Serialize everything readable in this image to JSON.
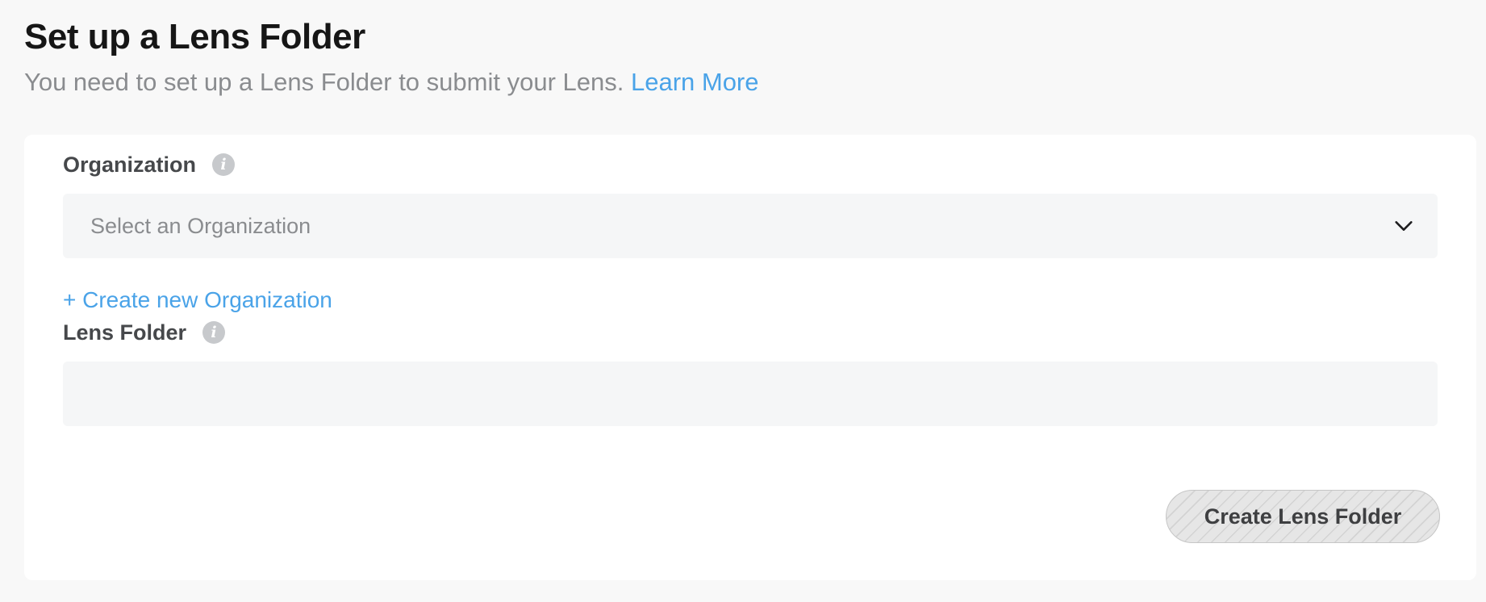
{
  "header": {
    "title": "Set up a Lens Folder",
    "subtitle": "You need to set up a Lens Folder to submit your Lens.",
    "learn_more_label": "Learn More"
  },
  "form": {
    "organization": {
      "label": "Organization",
      "info_icon": "info-icon",
      "placeholder": "Select an Organization",
      "dropdown_icon": "chevron-down-icon"
    },
    "create_org_label": "+ Create new Organization",
    "lens_folder": {
      "label": "Lens Folder",
      "info_icon": "info-icon",
      "value": ""
    },
    "submit_label": "Create Lens Folder",
    "submit_disabled": true
  },
  "colors": {
    "link": "#4aa3e8",
    "title": "#161616",
    "subtitle": "#8a8c8f",
    "page_background": "#f8f8f8",
    "card_background": "#ffffff",
    "input_background": "#f5f6f7"
  }
}
